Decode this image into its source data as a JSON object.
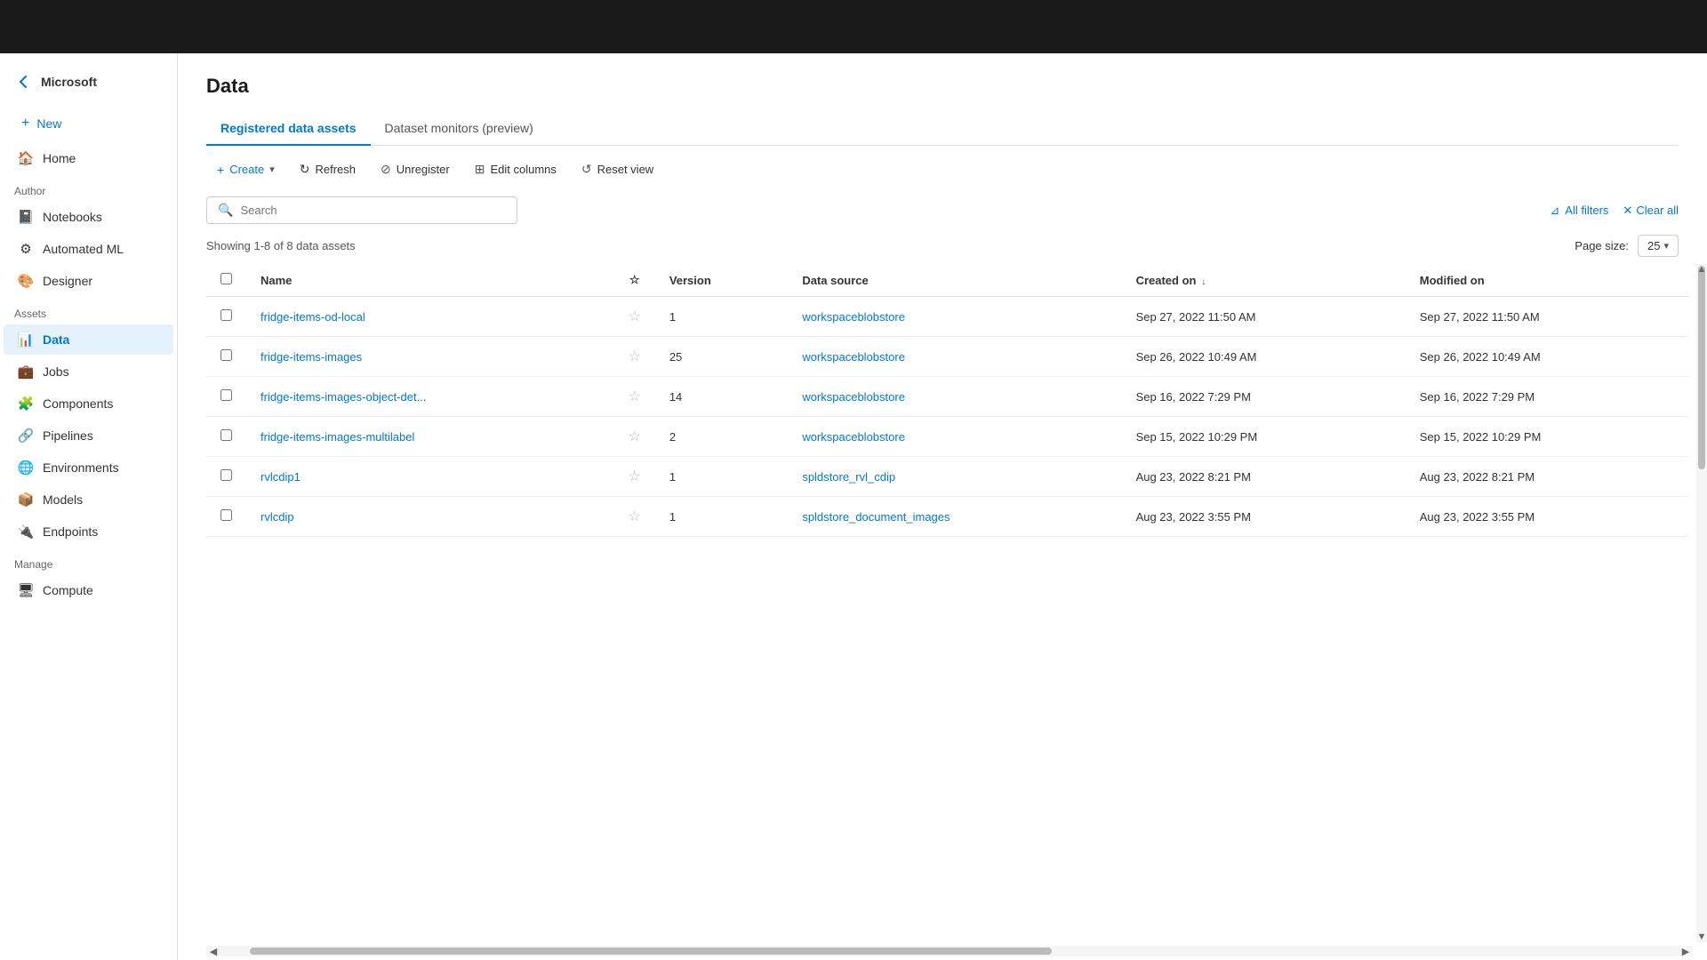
{
  "brand": {
    "name": "Microsoft"
  },
  "sidebar": {
    "new_label": "New",
    "sections": [
      {
        "label": "Author",
        "items": [
          {
            "id": "notebooks",
            "label": "Notebooks",
            "icon": "📓"
          },
          {
            "id": "automated-ml",
            "label": "Automated ML",
            "icon": "⚙"
          },
          {
            "id": "designer",
            "label": "Designer",
            "icon": "🎨"
          }
        ]
      },
      {
        "label": "Assets",
        "items": [
          {
            "id": "data",
            "label": "Data",
            "icon": "📊",
            "active": true
          },
          {
            "id": "jobs",
            "label": "Jobs",
            "icon": "💼"
          },
          {
            "id": "components",
            "label": "Components",
            "icon": "🧩"
          },
          {
            "id": "pipelines",
            "label": "Pipelines",
            "icon": "🔗"
          },
          {
            "id": "environments",
            "label": "Environments",
            "icon": "🌐"
          },
          {
            "id": "models",
            "label": "Models",
            "icon": "📦"
          },
          {
            "id": "endpoints",
            "label": "Endpoints",
            "icon": "🔌"
          }
        ]
      },
      {
        "label": "Manage",
        "items": [
          {
            "id": "compute",
            "label": "Compute",
            "icon": "🖥"
          }
        ]
      }
    ]
  },
  "page": {
    "title": "Data",
    "tabs": [
      {
        "id": "registered",
        "label": "Registered data assets",
        "active": true
      },
      {
        "id": "monitors",
        "label": "Dataset monitors (preview)",
        "active": false
      }
    ]
  },
  "toolbar": {
    "create_label": "Create",
    "refresh_label": "Refresh",
    "unregister_label": "Unregister",
    "edit_columns_label": "Edit columns",
    "reset_view_label": "Reset view"
  },
  "filter": {
    "search_placeholder": "Search",
    "all_filters_label": "All filters",
    "clear_all_label": "Clear all"
  },
  "results": {
    "text": "Showing 1-8 of 8 data assets",
    "page_size_label": "Page size:",
    "page_size_value": "25"
  },
  "table": {
    "columns": [
      {
        "id": "name",
        "label": "Name"
      },
      {
        "id": "star",
        "label": ""
      },
      {
        "id": "version",
        "label": "Version"
      },
      {
        "id": "data_source",
        "label": "Data source"
      },
      {
        "id": "created_on",
        "label": "Created on",
        "sortable": true,
        "sort_dir": "desc"
      },
      {
        "id": "modified_on",
        "label": "Modified on"
      }
    ],
    "rows": [
      {
        "name": "fridge-items-od-local",
        "version": "1",
        "data_source": "workspaceblobstore",
        "created_on": "Sep 27, 2022 11:50 AM",
        "modified_on": "Sep 27, 2022 11:50 AM"
      },
      {
        "name": "fridge-items-images",
        "version": "25",
        "data_source": "workspaceblobstore",
        "created_on": "Sep 26, 2022 10:49 AM",
        "modified_on": "Sep 26, 2022 10:49 AM"
      },
      {
        "name": "fridge-items-images-object-det...",
        "version": "14",
        "data_source": "workspaceblobstore",
        "created_on": "Sep 16, 2022 7:29 PM",
        "modified_on": "Sep 16, 2022 7:29 PM"
      },
      {
        "name": "fridge-items-images-multilabel",
        "version": "2",
        "data_source": "workspaceblobstore",
        "created_on": "Sep 15, 2022 10:29 PM",
        "modified_on": "Sep 15, 2022 10:29 PM"
      },
      {
        "name": "rvlcdip1",
        "version": "1",
        "data_source": "spldstore_rvl_cdip",
        "created_on": "Aug 23, 2022 8:21 PM",
        "modified_on": "Aug 23, 2022 8:21 PM"
      },
      {
        "name": "rvlcdip",
        "version": "1",
        "data_source": "spldstore_document_images",
        "created_on": "Aug 23, 2022 3:55 PM",
        "modified_on": "Aug 23, 2022 3:55 PM"
      }
    ]
  }
}
